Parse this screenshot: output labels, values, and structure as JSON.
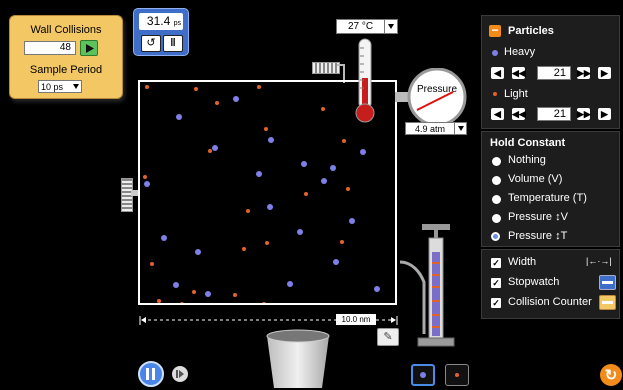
{
  "wall_collisions": {
    "title": "Wall Collisions",
    "count": "48",
    "sample_period_label": "Sample Period",
    "sample_period_value": "10 ps"
  },
  "stopwatch": {
    "time": "31.4",
    "unit": "ps",
    "reset_icon": "reset-icon",
    "pause_icon": "pause-icon"
  },
  "thermometer": {
    "value": "27 °C"
  },
  "gauge": {
    "label": "Pressure",
    "value": "4.9 atm"
  },
  "ruler": {
    "label": "10.0 nm"
  },
  "particles": {
    "title": "Particles",
    "heavy_label": "Heavy",
    "heavy_count": "21",
    "light_label": "Light",
    "light_count": "21",
    "heavy_color": "#7b7be0",
    "light_color": "#e2622b"
  },
  "hold_constant": {
    "title": "Hold Constant",
    "options": [
      "Nothing",
      "Volume (V)",
      "Temperature (T)",
      "Pressure ↕V",
      "Pressure ↕T"
    ],
    "selected_index": 4
  },
  "tools": {
    "width_label": "Width",
    "stopwatch_label": "Stopwatch",
    "collision_counter_label": "Collision Counter",
    "width_icon": "|←·→|"
  },
  "accent_colors": {
    "panel_yellow": "#f3c864",
    "stopwatch_blue": "#3f6ec9",
    "reset_orange": "#f28b1a"
  }
}
